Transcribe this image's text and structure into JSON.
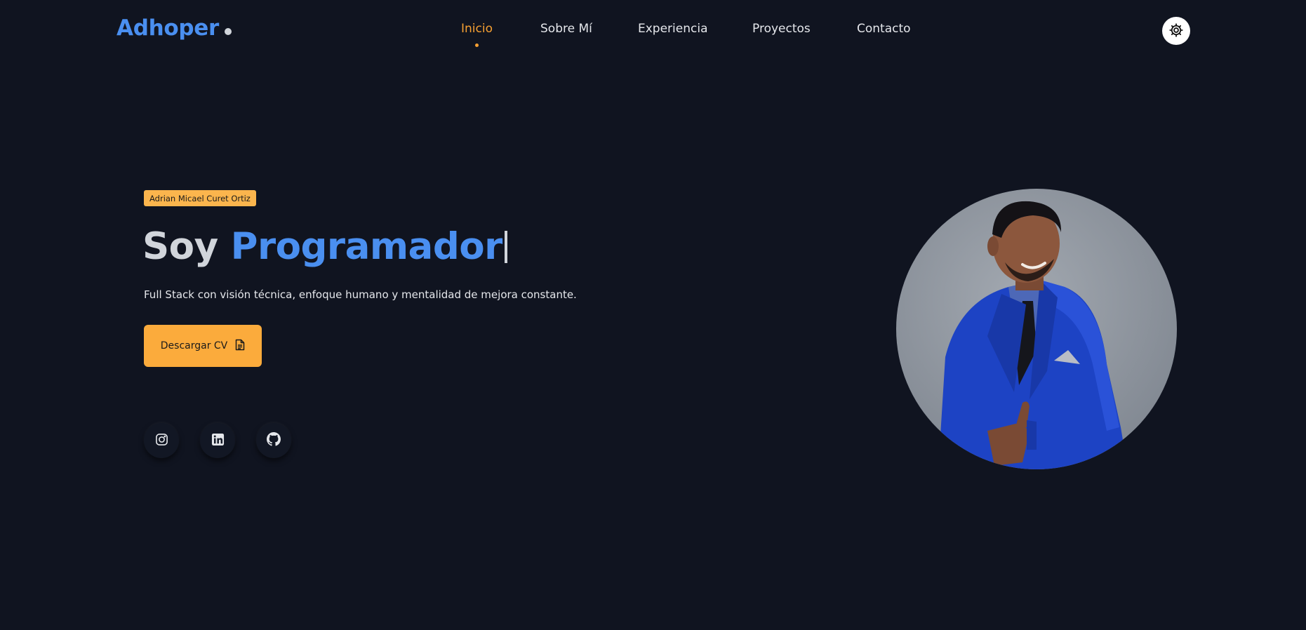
{
  "header": {
    "logo": "Adhoper",
    "nav": [
      {
        "label": "Inicio",
        "active": true
      },
      {
        "label": "Sobre Mí",
        "active": false
      },
      {
        "label": "Experiencia",
        "active": false
      },
      {
        "label": "Proyectos",
        "active": false
      },
      {
        "label": "Contacto",
        "active": false
      }
    ],
    "theme_toggle_icon": "gear-icon"
  },
  "hero": {
    "badge": "Adrian Micael Curet Ortiz",
    "headline_prefix": "Soy",
    "headline_role": "Programador",
    "subtitle": "Full Stack con visión técnica, enfoque humano y mentalidad de mejora constante.",
    "cv_button": {
      "label": "Descargar CV",
      "icon": "document-icon"
    },
    "socials": [
      {
        "name": "instagram",
        "icon": "instagram-icon"
      },
      {
        "name": "linkedin",
        "icon": "linkedin-icon"
      },
      {
        "name": "github",
        "icon": "github-icon"
      }
    ]
  },
  "colors": {
    "background": "#101420",
    "accent_blue": "#4a8ff0",
    "accent_orange": "#f6a032",
    "button_orange": "#fbab3c",
    "badge_orange": "#fbb54d"
  }
}
